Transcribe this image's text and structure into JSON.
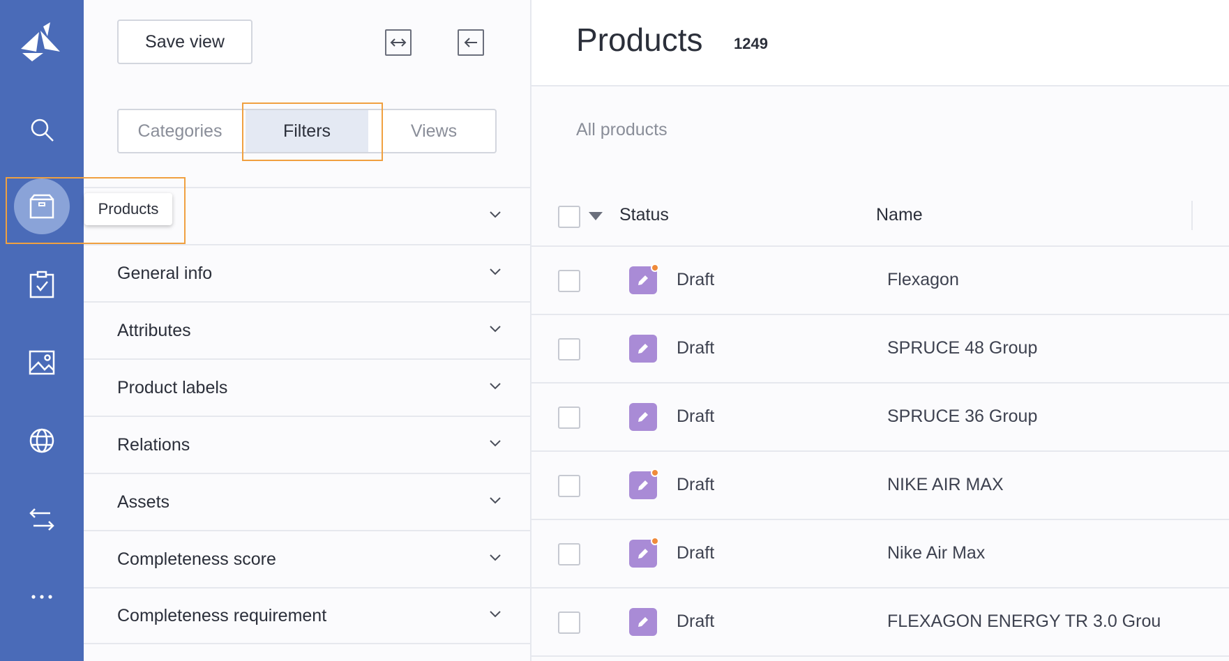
{
  "tooltip": {
    "label": "Products"
  },
  "panel": {
    "save_label": "Save view",
    "tabs": [
      {
        "label": "Categories",
        "active": false
      },
      {
        "label": "Filters",
        "active": true
      },
      {
        "label": "Views",
        "active": false
      }
    ],
    "sections": [
      {
        "label": ""
      },
      {
        "label": "General info"
      },
      {
        "label": "Attributes"
      },
      {
        "label": "Product labels"
      },
      {
        "label": "Relations"
      },
      {
        "label": "Assets"
      },
      {
        "label": "Completeness score"
      },
      {
        "label": "Completeness requirement"
      }
    ]
  },
  "header": {
    "title": "Products",
    "count": "1249"
  },
  "main": {
    "subtitle": "All products",
    "columns": {
      "status": "Status",
      "name": "Name"
    },
    "rows": [
      {
        "status": "Draft",
        "name": "Flexagon",
        "dot": true
      },
      {
        "status": "Draft",
        "name": "SPRUCE 48 Group",
        "dot": false
      },
      {
        "status": "Draft",
        "name": "SPRUCE 36 Group",
        "dot": false
      },
      {
        "status": "Draft",
        "name": "NIKE AIR MAX",
        "dot": true
      },
      {
        "status": "Draft",
        "name": "Nike Air Max",
        "dot": true
      },
      {
        "status": "Draft",
        "name": "FLEXAGON ENERGY TR 3.0 Grou",
        "dot": false
      }
    ]
  },
  "colors": {
    "rail": "#4a6bb8",
    "highlight": "#f0a040",
    "status_icon": "#a98bd6",
    "dot": "#ef8a3a"
  }
}
